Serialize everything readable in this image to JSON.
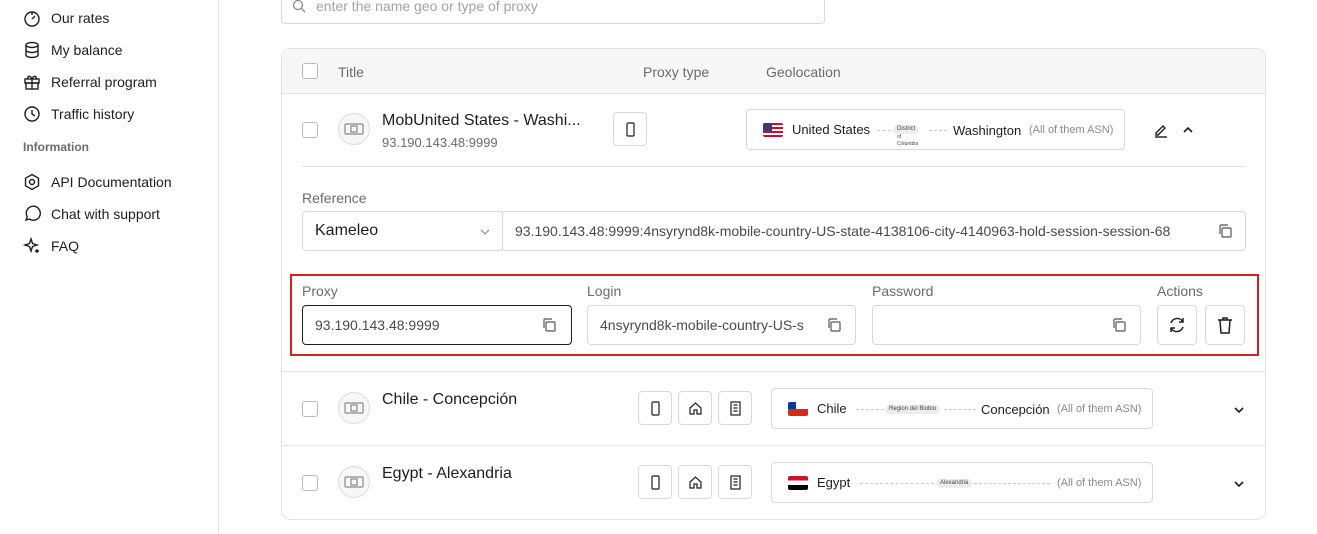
{
  "sidebar": {
    "items": [
      {
        "label": "Our rates",
        "icon": "timer-icon"
      },
      {
        "label": "My balance",
        "icon": "database-icon"
      },
      {
        "label": "Referral program",
        "icon": "gift-icon"
      },
      {
        "label": "Traffic history",
        "icon": "clock-icon"
      }
    ],
    "section_title": "Information",
    "info_items": [
      {
        "label": "API Documentation",
        "icon": "gear-icon"
      },
      {
        "label": "Chat with support",
        "icon": "chat-icon"
      },
      {
        "label": "FAQ",
        "icon": "sparkle-icon"
      }
    ]
  },
  "search": {
    "placeholder": "enter the name geo or type of proxy"
  },
  "table": {
    "headers": {
      "title": "Title",
      "proxy_type": "Proxy type",
      "geolocation": "Geolocation"
    },
    "rows": [
      {
        "title": "MobUnited States - Washi...",
        "subtitle": "93.190.143.48:9999",
        "country": "United States",
        "region_line1": "District",
        "region_line2": "of",
        "region_line3": "Columbia",
        "city": "Washington",
        "asn": "(All of them ASN)",
        "expanded": true
      },
      {
        "title": "Chile - Concepción",
        "country": "Chile",
        "region": "Region del Biobio",
        "city": "Concepción",
        "asn": "(All of them ASN)"
      },
      {
        "title": "Egypt - Alexandria",
        "country": "Egypt",
        "region": "Alexandria",
        "asn": "(All of them ASN)"
      }
    ],
    "expanded": {
      "reference_label": "Reference",
      "reference_select": "Kameleo",
      "reference_value": "93.190.143.48:9999:4nsyrynd8k-mobile-country-US-state-4138106-city-4140963-hold-session-session-68",
      "proxy_label": "Proxy",
      "proxy_value": "93.190.143.48:9999",
      "login_label": "Login",
      "login_value": "4nsyrynd8k-mobile-country-US-s",
      "password_label": "Password",
      "password_value": "",
      "actions_label": "Actions"
    }
  },
  "colors": {
    "highlight": "#d42020",
    "border": "#d9d9d9"
  }
}
